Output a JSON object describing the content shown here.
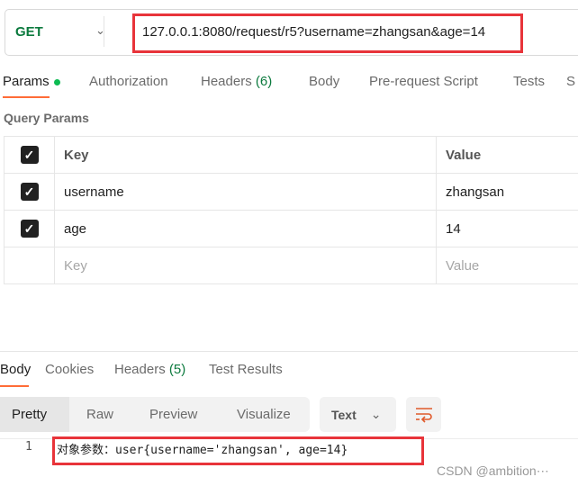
{
  "request": {
    "method": "GET",
    "url": "127.0.0.1:8080/request/r5?username=zhangsan&age=14"
  },
  "tabs": [
    {
      "label": "Params"
    },
    {
      "label": "Authorization"
    },
    {
      "label": "Headers",
      "count": "(6)"
    },
    {
      "label": "Body"
    },
    {
      "label": "Pre-request Script"
    },
    {
      "label": "Tests"
    },
    {
      "label": "S"
    }
  ],
  "query_params": {
    "title": "Query Params",
    "headers": {
      "key": "Key",
      "value": "Value"
    },
    "rows": [
      {
        "checked": true,
        "key": "username",
        "value": "zhangsan"
      },
      {
        "checked": true,
        "key": "age",
        "value": "14"
      }
    ],
    "placeholder": {
      "key": "Key",
      "value": "Value"
    }
  },
  "response": {
    "tabs": [
      {
        "label": "Body"
      },
      {
        "label": "Cookies"
      },
      {
        "label": "Headers",
        "count": "(5)"
      },
      {
        "label": "Test Results"
      }
    ],
    "views": [
      "Pretty",
      "Raw",
      "Preview",
      "Visualize"
    ],
    "format": "Text",
    "lines": [
      {
        "no": "1",
        "text": "对象参数：user{username='zhangsan', age=14}"
      }
    ]
  },
  "watermark": "CSDN @ambition⋯",
  "colors": {
    "accent": "#ff6c37",
    "method": "#0c7a3e",
    "highlight": "#e8343a"
  }
}
